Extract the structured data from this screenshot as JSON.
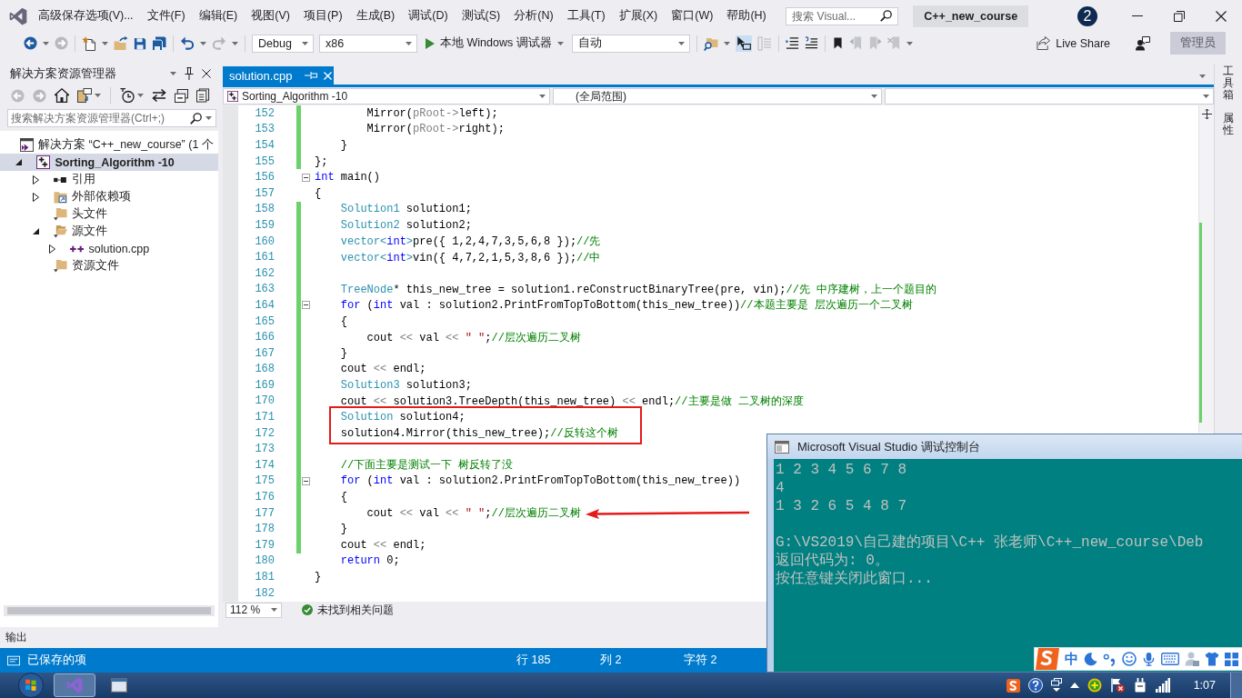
{
  "title_bar": {
    "menus": [
      "高级保存选项(V)...",
      "文件(F)",
      "编辑(E)",
      "视图(V)",
      "项目(P)",
      "生成(B)",
      "调试(D)",
      "测试(S)",
      "分析(N)",
      "工具(T)",
      "扩展(X)",
      "窗口(W)",
      "帮助(H)"
    ],
    "search": {
      "placeholder": "搜索 Visual..."
    },
    "project": "C++_new_course",
    "badge": "2"
  },
  "toolbar": {
    "configuration": "Debug",
    "platform": "x86",
    "run": "本地 Windows 调试器",
    "target": "自动",
    "live_share": "Live Share",
    "account": "管理员"
  },
  "solution_explorer": {
    "title": "解决方案资源管理器",
    "search": {
      "placeholder": "搜索解决方案资源管理器(Ctrl+;)"
    },
    "tree": [
      {
        "kind": "solution",
        "label": "解决方案 “C++_new_course” (1 个",
        "selected": false,
        "children": [
          {
            "kind": "project",
            "label": "Sorting_Algorithm -10",
            "expanded": true,
            "selected": true,
            "children": [
              {
                "kind": "references",
                "label": "引用",
                "expanded": false,
                "selected": false
              },
              {
                "kind": "external",
                "label": "外部依赖项",
                "expanded": false,
                "selected": false
              },
              {
                "kind": "folder",
                "label": "头文件",
                "selected": false
              },
              {
                "kind": "folder",
                "label": "源文件",
                "expanded": true,
                "selected": false,
                "children": [
                  {
                    "kind": "cpp",
                    "label": "solution.cpp",
                    "expanded": false,
                    "selected": false
                  }
                ]
              },
              {
                "kind": "folder",
                "label": "资源文件",
                "selected": false
              }
            ]
          }
        ]
      }
    ]
  },
  "editor": {
    "tab": {
      "label": "solution.cpp",
      "selected": true
    },
    "navigation": {
      "project": "Sorting_Algorithm -10",
      "scope": "(全局范围)"
    },
    "lines": [
      {
        "number": "152",
        "tokens": [
          {
            "kind": "plain",
            "text": "        Mirror("
          },
          {
            "kind": "param",
            "text": "pRoot"
          },
          {
            "kind": "operator",
            "text": "->"
          },
          {
            "kind": "plain",
            "text": "left);"
          }
        ],
        "changed": true,
        "fold": false,
        "framed": false,
        "arrow_target": false
      },
      {
        "number": "153",
        "tokens": [
          {
            "kind": "plain",
            "text": "        Mirror("
          },
          {
            "kind": "param",
            "text": "pRoot"
          },
          {
            "kind": "operator",
            "text": "->"
          },
          {
            "kind": "plain",
            "text": "right);"
          }
        ],
        "changed": true,
        "fold": false,
        "framed": false,
        "arrow_target": false
      },
      {
        "number": "154",
        "tokens": [
          {
            "kind": "plain",
            "text": "    }"
          }
        ],
        "changed": true,
        "fold": false,
        "framed": false,
        "arrow_target": false
      },
      {
        "number": "155",
        "tokens": [
          {
            "kind": "plain",
            "text": "};"
          }
        ],
        "changed": true,
        "fold": false,
        "framed": false,
        "arrow_target": false
      },
      {
        "number": "156",
        "tokens": [
          {
            "kind": "keyword",
            "text": "int"
          },
          {
            "kind": "plain",
            "text": " main()"
          }
        ],
        "changed": false,
        "fold": true,
        "framed": false,
        "arrow_target": false
      },
      {
        "number": "157",
        "tokens": [
          {
            "kind": "plain",
            "text": "{"
          }
        ],
        "changed": false,
        "fold": false,
        "framed": false,
        "arrow_target": false
      },
      {
        "number": "158",
        "tokens": [
          {
            "kind": "type",
            "text": "    Solution1"
          },
          {
            "kind": "plain",
            "text": " solution1;"
          }
        ],
        "changed": true,
        "fold": false,
        "framed": false,
        "arrow_target": false
      },
      {
        "number": "159",
        "tokens": [
          {
            "kind": "type",
            "text": "    Solution2"
          },
          {
            "kind": "plain",
            "text": " solution2;"
          }
        ],
        "changed": true,
        "fold": false,
        "framed": false,
        "arrow_target": false
      },
      {
        "number": "160",
        "tokens": [
          {
            "kind": "type",
            "text": "    vector<"
          },
          {
            "kind": "keyword",
            "text": "int"
          },
          {
            "kind": "type",
            "text": ">"
          },
          {
            "kind": "plain",
            "text": "pre({ 1,2,4,7,3,5,6,8 });"
          },
          {
            "kind": "comment",
            "text": "//先"
          }
        ],
        "changed": true,
        "fold": false,
        "framed": false,
        "arrow_target": false
      },
      {
        "number": "161",
        "tokens": [
          {
            "kind": "type",
            "text": "    vector<"
          },
          {
            "kind": "keyword",
            "text": "int"
          },
          {
            "kind": "type",
            "text": ">"
          },
          {
            "kind": "plain",
            "text": "vin({ 4,7,2,1,5,3,8,6 });"
          },
          {
            "kind": "comment",
            "text": "//中"
          }
        ],
        "changed": true,
        "fold": false,
        "framed": false,
        "arrow_target": false
      },
      {
        "number": "162",
        "changed": true,
        "fold": false,
        "framed": false,
        "arrow_target": false
      },
      {
        "number": "163",
        "tokens": [
          {
            "kind": "type",
            "text": "    TreeNode"
          },
          {
            "kind": "plain",
            "text": "* this_new_tree = solution1.reConstructBinaryTree(pre, vin);"
          },
          {
            "kind": "comment",
            "text": "//先 中序建树，上一个题目的"
          }
        ],
        "changed": true,
        "fold": false,
        "framed": false,
        "arrow_target": false
      },
      {
        "number": "164",
        "tokens": [
          {
            "kind": "keyword",
            "text": "    for"
          },
          {
            "kind": "plain",
            "text": " ("
          },
          {
            "kind": "keyword",
            "text": "int"
          },
          {
            "kind": "plain",
            "text": " val : solution2.PrintFromTopToBottom(this_new_tree))"
          },
          {
            "kind": "comment",
            "text": "//本题主要是 层次遍历一个二叉树"
          }
        ],
        "changed": true,
        "fold": true,
        "framed": false,
        "arrow_target": false
      },
      {
        "number": "165",
        "tokens": [
          {
            "kind": "plain",
            "text": "    {"
          }
        ],
        "changed": true,
        "fold": false,
        "framed": false,
        "arrow_target": false
      },
      {
        "number": "166",
        "tokens": [
          {
            "kind": "plain",
            "text": "        cout "
          },
          {
            "kind": "operator",
            "text": "<<"
          },
          {
            "kind": "plain",
            "text": " val "
          },
          {
            "kind": "operator",
            "text": "<<"
          },
          {
            "kind": "string",
            "text": " \" \""
          },
          {
            "kind": "plain",
            "text": ";"
          },
          {
            "kind": "comment",
            "text": "//层次遍历二叉树"
          }
        ],
        "changed": true,
        "fold": false,
        "framed": false,
        "arrow_target": false
      },
      {
        "number": "167",
        "tokens": [
          {
            "kind": "plain",
            "text": "    }"
          }
        ],
        "changed": true,
        "fold": false,
        "framed": false,
        "arrow_target": false
      },
      {
        "number": "168",
        "tokens": [
          {
            "kind": "plain",
            "text": "    cout "
          },
          {
            "kind": "operator",
            "text": "<<"
          },
          {
            "kind": "plain",
            "text": " endl;"
          }
        ],
        "changed": true,
        "fold": false,
        "framed": false,
        "arrow_target": false
      },
      {
        "number": "169",
        "tokens": [
          {
            "kind": "type",
            "text": "    Solution3"
          },
          {
            "kind": "plain",
            "text": " solution3;"
          }
        ],
        "changed": true,
        "fold": false,
        "framed": false,
        "arrow_target": false
      },
      {
        "number": "170",
        "tokens": [
          {
            "kind": "plain",
            "text": "    cout "
          },
          {
            "kind": "operator",
            "text": "<<"
          },
          {
            "kind": "plain",
            "text": " solution3.TreeDepth(this_new_tree) "
          },
          {
            "kind": "operator",
            "text": "<<"
          },
          {
            "kind": "plain",
            "text": " endl;"
          },
          {
            "kind": "comment",
            "text": "//主要是做 二叉树的深度"
          }
        ],
        "changed": true,
        "fold": false,
        "framed": false,
        "arrow_target": false
      },
      {
        "number": "171",
        "tokens": [
          {
            "kind": "type",
            "text": "    Solution"
          },
          {
            "kind": "plain",
            "text": " solution4;"
          }
        ],
        "changed": true,
        "fold": false,
        "framed": true,
        "arrow_target": false
      },
      {
        "number": "172",
        "tokens": [
          {
            "kind": "plain",
            "text": "    solution4.Mirror(this_new_tree);"
          },
          {
            "kind": "comment",
            "text": "//反转这个树"
          }
        ],
        "changed": true,
        "fold": false,
        "framed": true,
        "arrow_target": false
      },
      {
        "number": "173",
        "changed": true,
        "fold": false,
        "framed": false,
        "arrow_target": false
      },
      {
        "number": "174",
        "tokens": [
          {
            "kind": "comment",
            "text": "    //下面主要是测试一下 树反转了没"
          }
        ],
        "changed": true,
        "fold": false,
        "framed": false,
        "arrow_target": false
      },
      {
        "number": "175",
        "tokens": [
          {
            "kind": "keyword",
            "text": "    for"
          },
          {
            "kind": "plain",
            "text": " ("
          },
          {
            "kind": "keyword",
            "text": "int"
          },
          {
            "kind": "plain",
            "text": " val : solution2.PrintFromTopToBottom(this_new_tree))"
          }
        ],
        "changed": true,
        "fold": true,
        "framed": false,
        "arrow_target": false
      },
      {
        "number": "176",
        "tokens": [
          {
            "kind": "plain",
            "text": "    {"
          }
        ],
        "changed": true,
        "fold": false,
        "framed": false,
        "arrow_target": false
      },
      {
        "number": "177",
        "tokens": [
          {
            "kind": "plain",
            "text": "        cout "
          },
          {
            "kind": "operator",
            "text": "<<"
          },
          {
            "kind": "plain",
            "text": " val "
          },
          {
            "kind": "operator",
            "text": "<<"
          },
          {
            "kind": "string",
            "text": " \" \""
          },
          {
            "kind": "plain",
            "text": ";"
          },
          {
            "kind": "comment",
            "text": "//层次遍历二叉树"
          }
        ],
        "changed": true,
        "fold": false,
        "framed": false,
        "arrow_target": true
      },
      {
        "number": "178",
        "tokens": [
          {
            "kind": "plain",
            "text": "    }"
          }
        ],
        "changed": true,
        "fold": false,
        "framed": false,
        "arrow_target": false
      },
      {
        "number": "179",
        "tokens": [
          {
            "kind": "plain",
            "text": "    cout "
          },
          {
            "kind": "operator",
            "text": "<<"
          },
          {
            "kind": "plain",
            "text": " endl;"
          }
        ],
        "changed": true,
        "fold": false,
        "framed": false,
        "arrow_target": false
      },
      {
        "number": "180",
        "tokens": [
          {
            "kind": "keyword",
            "text": "    return"
          },
          {
            "kind": "plain",
            "text": " 0;"
          }
        ],
        "changed": false,
        "fold": false,
        "framed": false,
        "arrow_target": false
      },
      {
        "number": "181",
        "tokens": [
          {
            "kind": "plain",
            "text": "}"
          }
        ],
        "changed": false,
        "fold": false,
        "framed": false,
        "arrow_target": false
      },
      {
        "number": "182",
        "changed": false,
        "fold": false,
        "framed": false,
        "arrow_target": false
      }
    ],
    "zoom": "112 %",
    "issues": "未找到相关问题"
  },
  "side_tabs": [
    "工具箱",
    "属性"
  ],
  "output_tab": "输出",
  "status_bar": {
    "message": "已保存的项",
    "line": "行 185",
    "column": "列 2",
    "char": "字符 2"
  },
  "console": {
    "title": "Microsoft Visual Studio 调试控制台",
    "output": [
      "1 2 3 4 5 6 7 8",
      "4",
      "1 3 2 6 5 4 8 7"
    ],
    "exit_message": [
      "G:\\VS2019\\自己建的项目\\C++ 张老师\\C++_new_course\\Deb",
      "返回代码为: 0。",
      "按任意键关闭此窗口..."
    ]
  },
  "ime_bar": {
    "mode": "中"
  },
  "taskbar": {
    "apps": [
      {
        "kind": "visual_studio",
        "active": true
      },
      {
        "kind": "window",
        "active": false
      }
    ],
    "clock": "1:07"
  }
}
